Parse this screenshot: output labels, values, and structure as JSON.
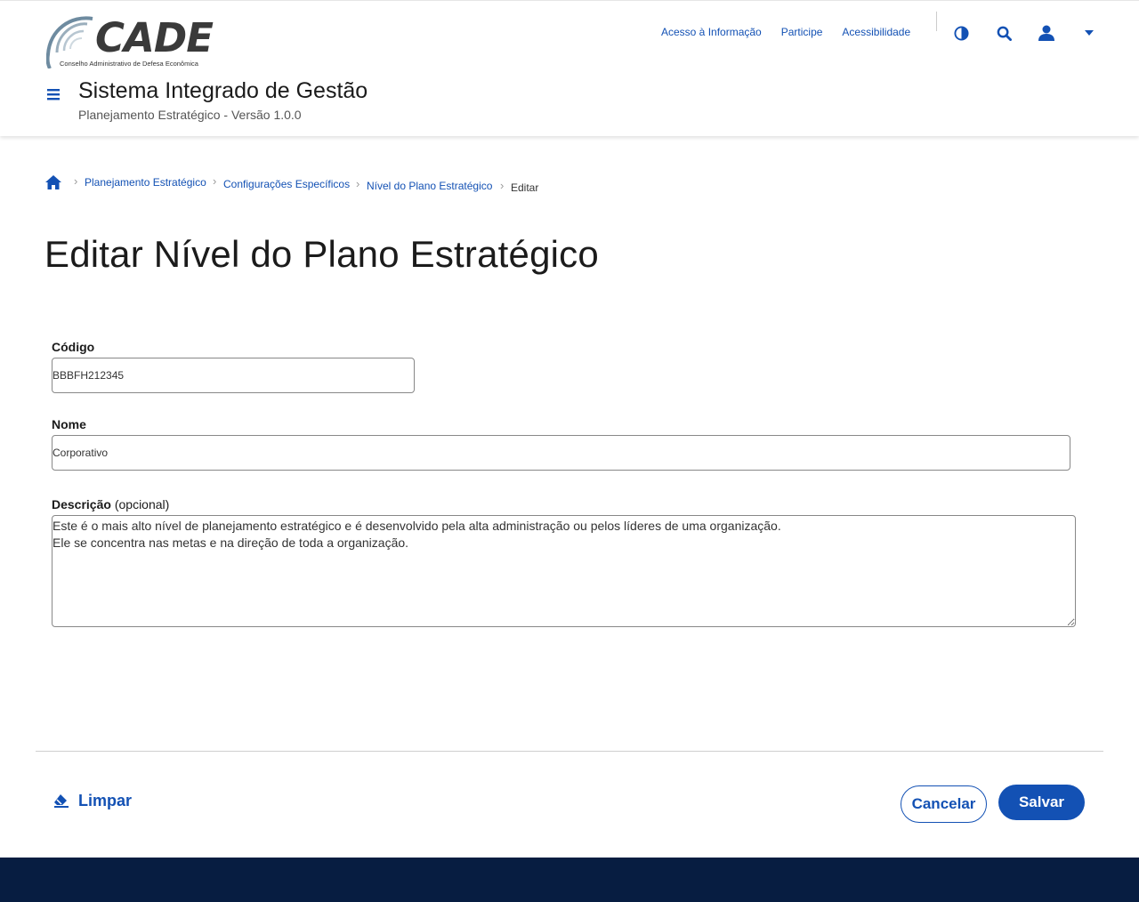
{
  "header": {
    "logo_text": "CADE",
    "logo_subtitle": "Conselho Administrativo de Defesa Econômica",
    "system_title": "Sistema Integrado de Gestão",
    "system_subtitle": "Planejamento Estratégico - Versão 1.0.0",
    "links": [
      "Acesso à Informação",
      "Participe",
      "Acessibilidade"
    ],
    "icons": [
      "contrast-icon",
      "search-icon",
      "user-icon",
      "caret-down-icon"
    ]
  },
  "breadcrumb": {
    "items": [
      "Planejamento Estratégico",
      "Configurações Específicos",
      "Nível do Plano Estratégico"
    ],
    "current": "Editar"
  },
  "page": {
    "title": "Editar Nível do Plano Estratégico"
  },
  "form": {
    "codigo": {
      "label": "Código",
      "value": "BBBFH212345"
    },
    "nome": {
      "label": "Nome",
      "value": "Corporativo"
    },
    "descricao": {
      "label": "Descrição",
      "optional": "(opcional)",
      "value": "Este é o mais alto nível de planejamento estratégico e é desenvolvido pela alta administração ou pelos líderes de uma organização.\nEle se concentra nas metas e na direção de toda a organização."
    }
  },
  "actions": {
    "clear": "Limpar",
    "cancel": "Cancelar",
    "save": "Salvar"
  },
  "colors": {
    "primary": "#1351b4",
    "footer": "#071d41"
  }
}
